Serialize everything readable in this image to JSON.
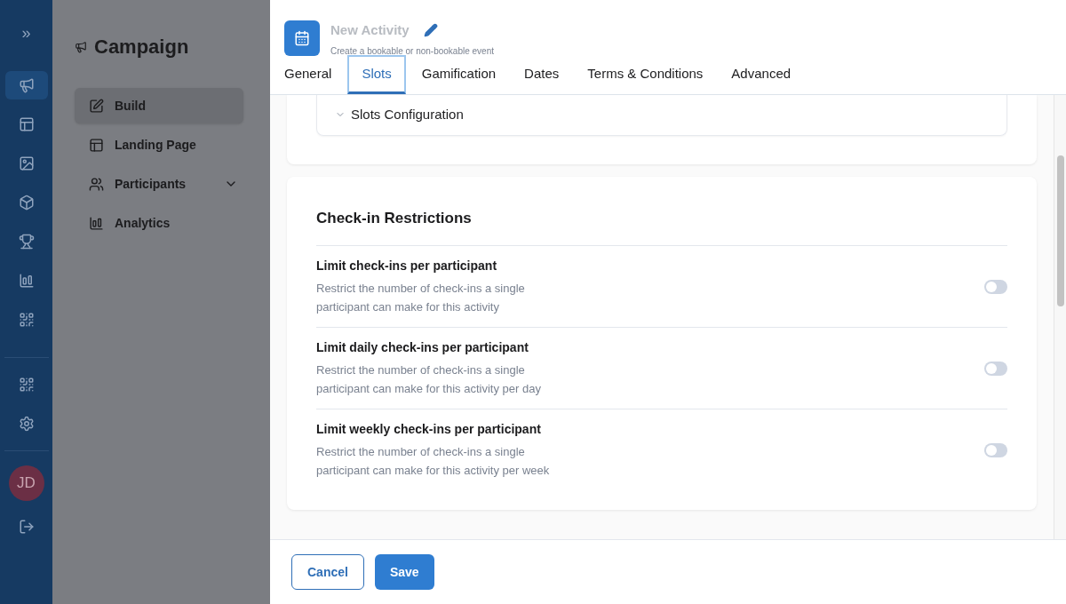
{
  "rail": {
    "expand": "»",
    "items": [
      {
        "kind": "megaphone",
        "selected": true
      },
      {
        "kind": "layout",
        "selected": false
      },
      {
        "kind": "image",
        "selected": false
      },
      {
        "kind": "cube",
        "selected": false
      },
      {
        "kind": "trophy",
        "selected": false
      },
      {
        "kind": "chart",
        "selected": false
      },
      {
        "kind": "qr",
        "selected": false
      }
    ],
    "bottom": [
      {
        "kind": "qr"
      },
      {
        "kind": "settings"
      }
    ],
    "avatar": "JD"
  },
  "sidebar": {
    "title": "Campaign",
    "items": [
      {
        "label": "Build",
        "kind": "edit",
        "selected": true,
        "expandable": false
      },
      {
        "label": "Landing Page",
        "kind": "layout",
        "selected": false,
        "expandable": false
      },
      {
        "label": "Participants",
        "kind": "users",
        "selected": false,
        "expandable": true
      },
      {
        "label": "Analytics",
        "kind": "chart",
        "selected": false,
        "expandable": false
      }
    ]
  },
  "panel": {
    "title": "New Activity",
    "subtitle": "Create a bookable or non-bookable event",
    "tabs": [
      {
        "label": "General",
        "selected": false
      },
      {
        "label": "Slots",
        "selected": true
      },
      {
        "label": "Gamification",
        "selected": false
      },
      {
        "label": "Dates",
        "selected": false
      },
      {
        "label": "Terms & Conditions",
        "selected": false
      },
      {
        "label": "Advanced",
        "selected": false
      }
    ],
    "accordion": {
      "label": "Slots Configuration",
      "expanded": false
    },
    "section": {
      "title": "Check-in Restrictions",
      "rows": [
        {
          "title": "Limit check-ins per participant",
          "description": [
            "Restrict the number of check-ins a single",
            "participant can make for this activity"
          ],
          "checked": false
        },
        {
          "title": "Limit daily check-ins per participant",
          "description": [
            "Restrict the number of check-ins a single",
            "participant can make for this activity per day"
          ],
          "checked": false
        },
        {
          "title": "Limit weekly check-ins per participant",
          "description": [
            "Restrict the number of check-ins a single",
            "participant can make for this activity per week"
          ],
          "checked": false
        }
      ]
    },
    "buttons": [
      {
        "label": "Cancel",
        "kind": "secondary"
      },
      {
        "label": "Save",
        "kind": "primary"
      }
    ]
  }
}
